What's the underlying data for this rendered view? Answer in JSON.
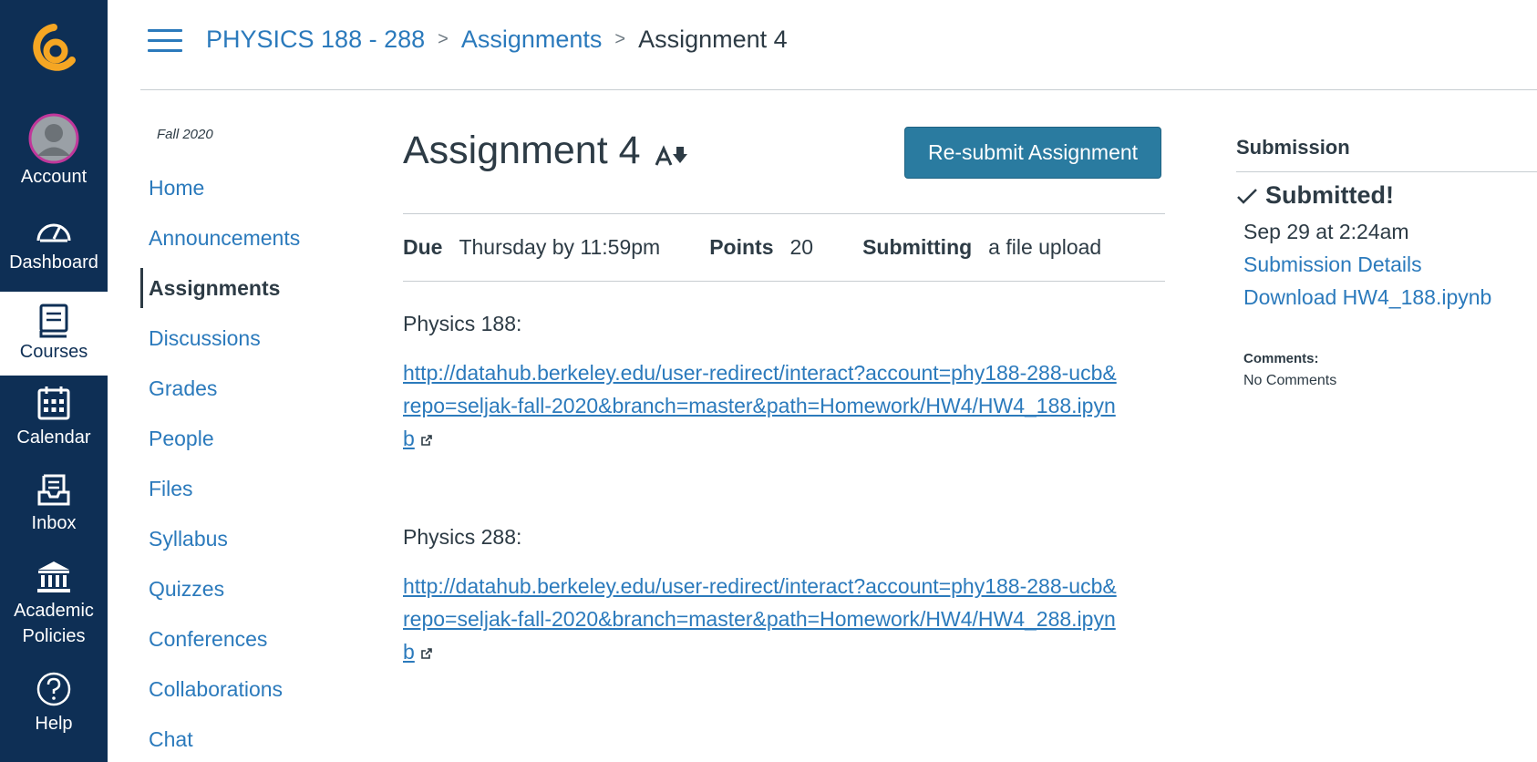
{
  "global_nav": {
    "items": [
      {
        "label": "Account",
        "icon": "avatar-icon"
      },
      {
        "label": "Dashboard",
        "icon": "dashboard-icon"
      },
      {
        "label": "Courses",
        "icon": "courses-icon"
      },
      {
        "label": "Calendar",
        "icon": "calendar-icon"
      },
      {
        "label": "Inbox",
        "icon": "inbox-icon"
      },
      {
        "label": "Academic Policies",
        "icon": "institution-icon"
      },
      {
        "label": "Help",
        "icon": "help-icon"
      }
    ],
    "active": "Courses",
    "colors": {
      "background": "#0e2f55",
      "logo_accent": "#f5a623"
    }
  },
  "breadcrumb": {
    "course": "PHYSICS 188 - 288",
    "section": "Assignments",
    "current": "Assignment 4"
  },
  "course_nav": {
    "term": "Fall 2020",
    "items": [
      "Home",
      "Announcements",
      "Assignments",
      "Discussions",
      "Grades",
      "People",
      "Files",
      "Syllabus",
      "Quizzes",
      "Conferences",
      "Collaborations",
      "Chat"
    ],
    "active": "Assignments"
  },
  "assignment": {
    "title": "Assignment 4",
    "resubmit_label": "Re-submit Assignment",
    "due_label": "Due",
    "due_value": "Thursday by 11:59pm",
    "points_label": "Points",
    "points_value": "20",
    "submitting_label": "Submitting",
    "submitting_value": "a file upload",
    "description": [
      {
        "label": "Physics 188:",
        "link": "http://datahub.berkeley.edu/user-redirect/interact?account=phy188-288-ucb&repo=seljak-fall-2020&branch=master&path=Homework/HW4/HW4_188.ipynb"
      },
      {
        "label": "Physics 288:",
        "link": "http://datahub.berkeley.edu/user-redirect/interact?account=phy188-288-ucb&repo=seljak-fall-2020&branch=master&path=Homework/HW4/HW4_288.ipynb"
      }
    ]
  },
  "submission": {
    "title": "Submission",
    "status": "Submitted!",
    "date": "Sep 29 at 2:24am",
    "details_link": "Submission Details",
    "download_link": "Download HW4_188.ipynb",
    "comments_label": "Comments:",
    "comments_value": "No Comments"
  }
}
